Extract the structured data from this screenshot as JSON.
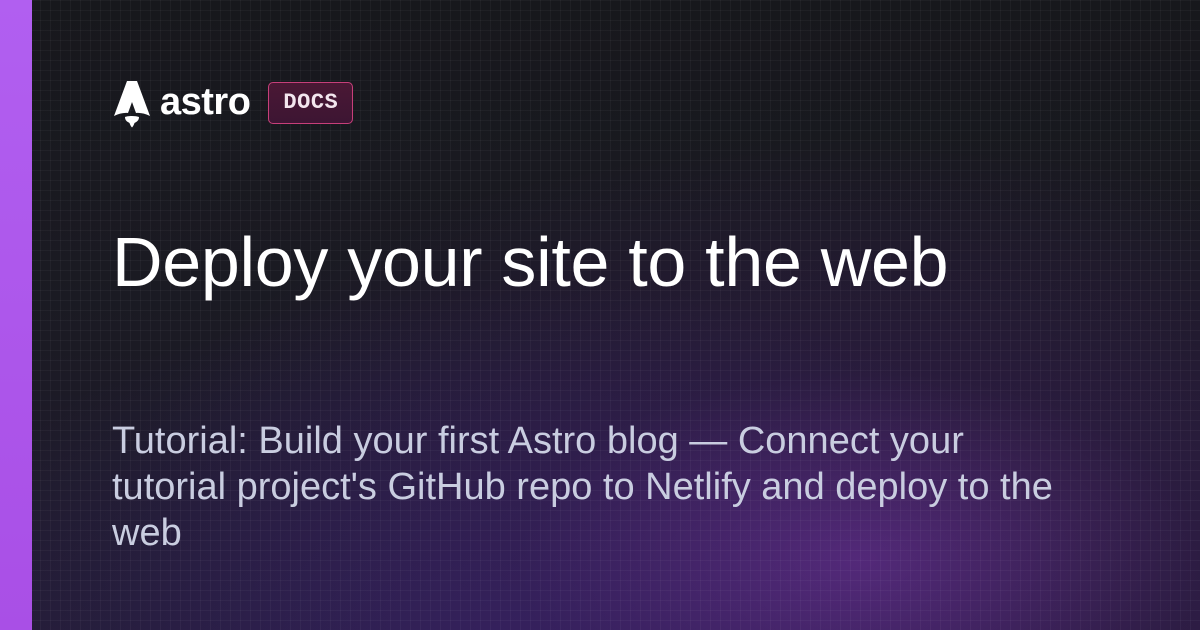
{
  "brand": {
    "logo_icon": "astro-rocket-icon",
    "name": "astro",
    "badge": "DOCS"
  },
  "page": {
    "title": "Deploy your site to the web",
    "subtitle_prefix": "Tutorial: Build your first Astro blog",
    "subtitle_separator": " — ",
    "subtitle_body": "Connect your tutorial project's GitHub repo to Netlify and deploy to the web"
  },
  "colors": {
    "accent_bar": "#b15ff0",
    "badge_border": "#c73f7a",
    "background": "#17181c",
    "title_text": "#ffffff",
    "subtitle_text": "#c9cde0"
  }
}
